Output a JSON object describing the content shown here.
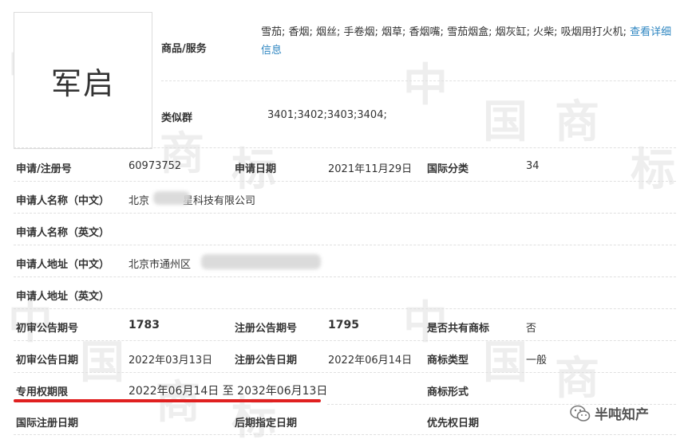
{
  "logo": {
    "text": "军启"
  },
  "goods": {
    "label": "商品/服务",
    "text": "雪茄; 香烟; 烟丝; 手卷烟; 烟草; 香烟嘴; 雪茄烟盒; 烟灰缸; 火柴; 吸烟用打火机;",
    "link": "查看详细信息"
  },
  "similar_group": {
    "label": "类似群",
    "value": "3401;3402;3403;3404;"
  },
  "reg_no": {
    "label": "申请/注册号",
    "value": "60973752"
  },
  "app_date": {
    "label": "申请日期",
    "value": "2021年11月29日"
  },
  "intl_class": {
    "label": "国际分类",
    "value": "34"
  },
  "applicant_cn": {
    "label": "申请人名称（中文）",
    "value_prefix": "北京",
    "value_suffix": "星科技有限公司"
  },
  "applicant_en": {
    "label": "申请人名称（英文）",
    "value": ""
  },
  "address_cn": {
    "label": "申请人地址（中文）",
    "value_prefix": "北京市通州区",
    "value_suffix": ""
  },
  "address_en": {
    "label": "申请人地址（英文）",
    "value": ""
  },
  "prelim_pub_no": {
    "label": "初审公告期号",
    "value": "1783"
  },
  "reg_pub_no": {
    "label": "注册公告期号",
    "value": "1795"
  },
  "shared": {
    "label": "是否共有商标",
    "value": "否"
  },
  "prelim_pub_date": {
    "label": "初审公告日期",
    "value": "2022年03月13日"
  },
  "reg_pub_date": {
    "label": "注册公告日期",
    "value": "2022年06月14日"
  },
  "tm_type": {
    "label": "商标类型",
    "value": "一般"
  },
  "exclusive_period": {
    "label": "专用权期限",
    "value": "2022年06月14日 至 2032年06月13日"
  },
  "tm_form": {
    "label": "商标形式",
    "value": ""
  },
  "intl_reg_date": {
    "label": "国际注册日期",
    "value": ""
  },
  "later_designation": {
    "label": "后期指定日期",
    "value": ""
  },
  "priority_date": {
    "label": "优先权日期",
    "value": ""
  },
  "watermark": {
    "chars": [
      "中",
      "国",
      "商",
      "标"
    ]
  },
  "wechat": {
    "label": "半吨知产",
    "icon": "wechat-icon"
  },
  "colors": {
    "link": "#2e86c1",
    "underline": "#e02020"
  }
}
